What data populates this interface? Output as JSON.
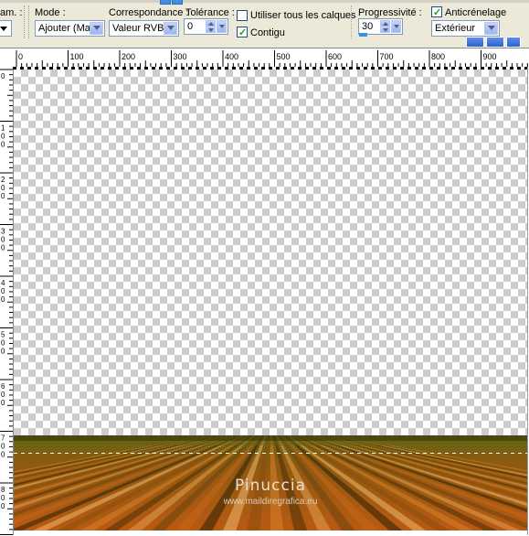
{
  "toolbar": {
    "cut_label": "am. :",
    "mode": {
      "label": "Mode :",
      "value": "Ajouter (Maj)"
    },
    "match": {
      "label": "Correspondance :",
      "value": "Valeur RVB"
    },
    "tolerance": {
      "label": "Tolérance :",
      "value": "0"
    },
    "all_layers": {
      "label": "Utiliser tous les calques",
      "checked": false
    },
    "contiguous": {
      "label": "Contigu",
      "checked": true
    },
    "feather": {
      "label": "Progressivité :",
      "value": "30"
    },
    "antialias": {
      "label": "Anticrénelage",
      "checked": true,
      "value": "Extérieur"
    }
  },
  "ruler": {
    "h_labels": [
      "0",
      "100",
      "200",
      "300",
      "400",
      "500",
      "600",
      "700",
      "800",
      "900"
    ],
    "v_labels": [
      "0",
      "100",
      "200",
      "300",
      "400",
      "500",
      "600",
      "700",
      "800"
    ]
  },
  "watermark": {
    "name": "Pinuccia",
    "url": "www.maildiregrafica.eu"
  },
  "colors": {
    "accent": "#3E8FE0",
    "checkbox_tick": "#21A121",
    "stripe_orange": "#C8661A",
    "stripe_green": "#5C6A16"
  }
}
